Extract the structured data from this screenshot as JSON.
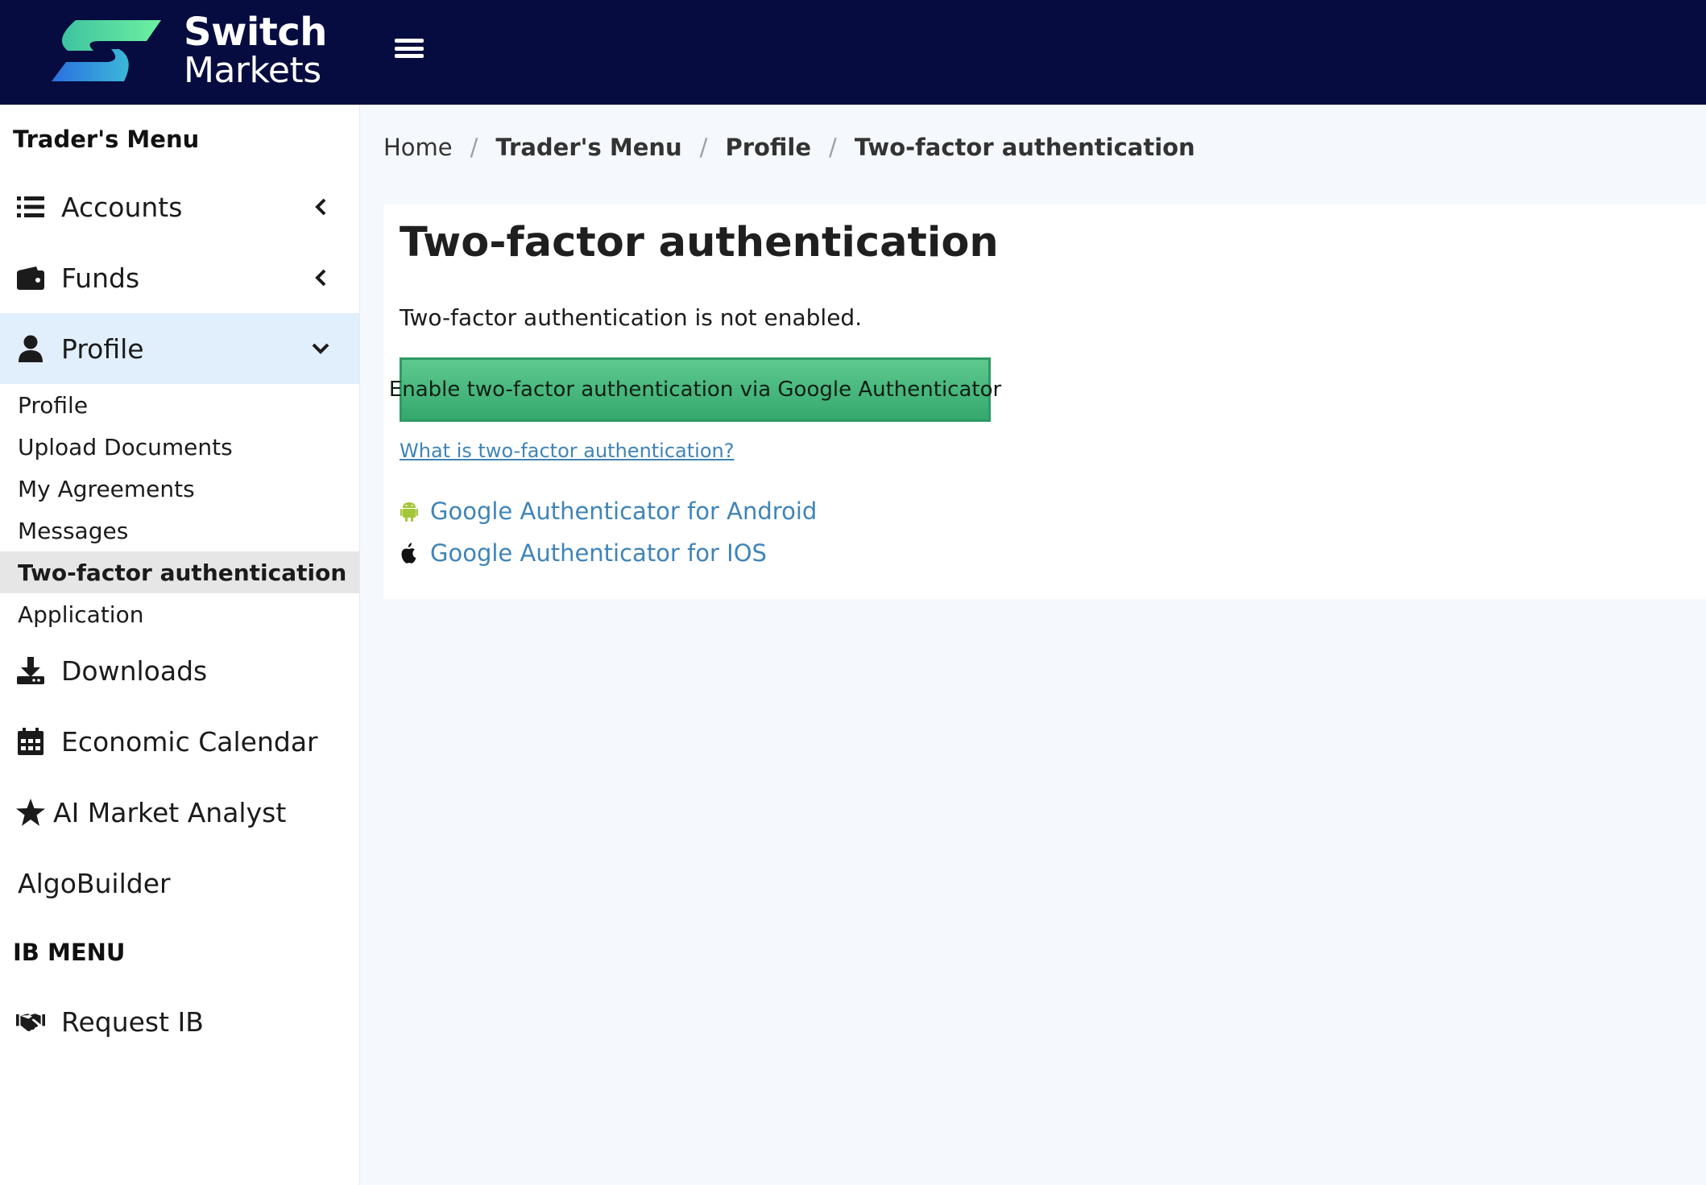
{
  "brand": {
    "line1": "Switch",
    "line2": "Markets"
  },
  "sidebar": {
    "traders_heading": "Trader's Menu",
    "items": [
      {
        "label": "Accounts",
        "icon": "list-icon"
      },
      {
        "label": "Funds",
        "icon": "wallet-icon"
      },
      {
        "label": "Profile",
        "icon": "user-icon"
      }
    ],
    "profile_subitems": [
      {
        "label": "Profile"
      },
      {
        "label": "Upload Documents"
      },
      {
        "label": "My Agreements"
      },
      {
        "label": "Messages"
      },
      {
        "label": "Two-factor authentication"
      },
      {
        "label": "Application"
      }
    ],
    "items_lower": [
      {
        "label": "Downloads",
        "icon": "download-icon"
      },
      {
        "label": "Economic Calendar",
        "icon": "calendar-icon"
      },
      {
        "label": "AI Market Analyst",
        "icon": "star-icon"
      },
      {
        "label": "AlgoBuilder"
      }
    ],
    "ib_heading": "IB MENU",
    "ib_items": [
      {
        "label": "Request IB",
        "icon": "handshake-icon"
      }
    ]
  },
  "breadcrumb": [
    "Home",
    "Trader's Menu",
    "Profile",
    "Two-factor authentication"
  ],
  "main": {
    "title": "Two-factor authentication",
    "status_text": "Two-factor authentication is not enabled.",
    "enable_button": "Enable two-factor authentication via Google Authenticator",
    "what_link": "What is two-factor authentication?",
    "android_link": "Google Authenticator for Android",
    "ios_link": "Google Authenticator for IOS"
  },
  "colors": {
    "topbar": "#060c3f",
    "active_nav": "#e1eefc",
    "button_green": "#4cbb80",
    "link_blue": "#3f84b8",
    "android_green": "#a4c639"
  }
}
